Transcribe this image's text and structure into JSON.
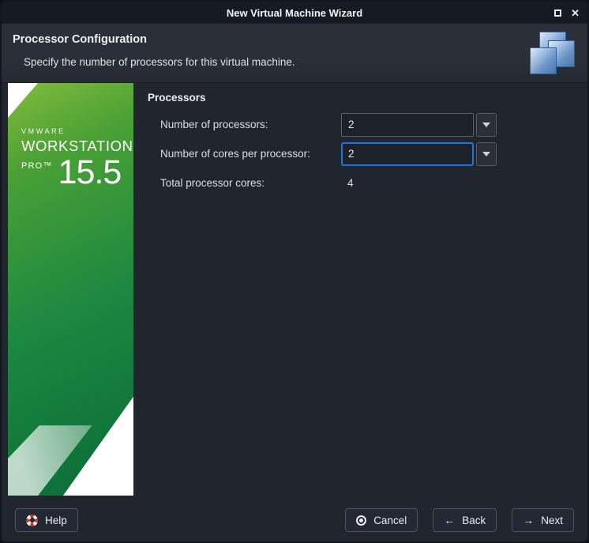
{
  "window": {
    "title": "New Virtual Machine Wizard",
    "controls": {
      "close_glyph": "✕"
    }
  },
  "header": {
    "title": "Processor Configuration",
    "subtitle": "Specify the number of processors for this virtual machine.",
    "icon": "overlapping-windows-icon"
  },
  "sidebar": {
    "brand_top": "VMWARE",
    "brand_main": "WORKSTATION",
    "brand_sub": "PRO™",
    "brand_version": "15.5"
  },
  "form": {
    "group_title": "Processors",
    "rows": [
      {
        "label": "Number of processors:",
        "value": "2",
        "type": "dropdown",
        "focused": false
      },
      {
        "label": "Number of cores per processor:",
        "value": "2",
        "type": "dropdown",
        "focused": true
      },
      {
        "label": "Total processor cores:",
        "value": "4",
        "type": "static"
      }
    ]
  },
  "footer": {
    "help_label": "Help",
    "cancel_label": "Cancel",
    "back_label": "Back",
    "next_label": "Next",
    "back_arrow": "←",
    "next_arrow": "→"
  },
  "colors": {
    "focus_blue": "#2273e2",
    "sidebar_green_light": "#82bb3c",
    "sidebar_green_dark": "#0a6c37",
    "buoy_red": "#c8382b",
    "titlebar_bg": "#161a22",
    "header_bg": "#2b2f39",
    "content_bg": "#21252d"
  }
}
